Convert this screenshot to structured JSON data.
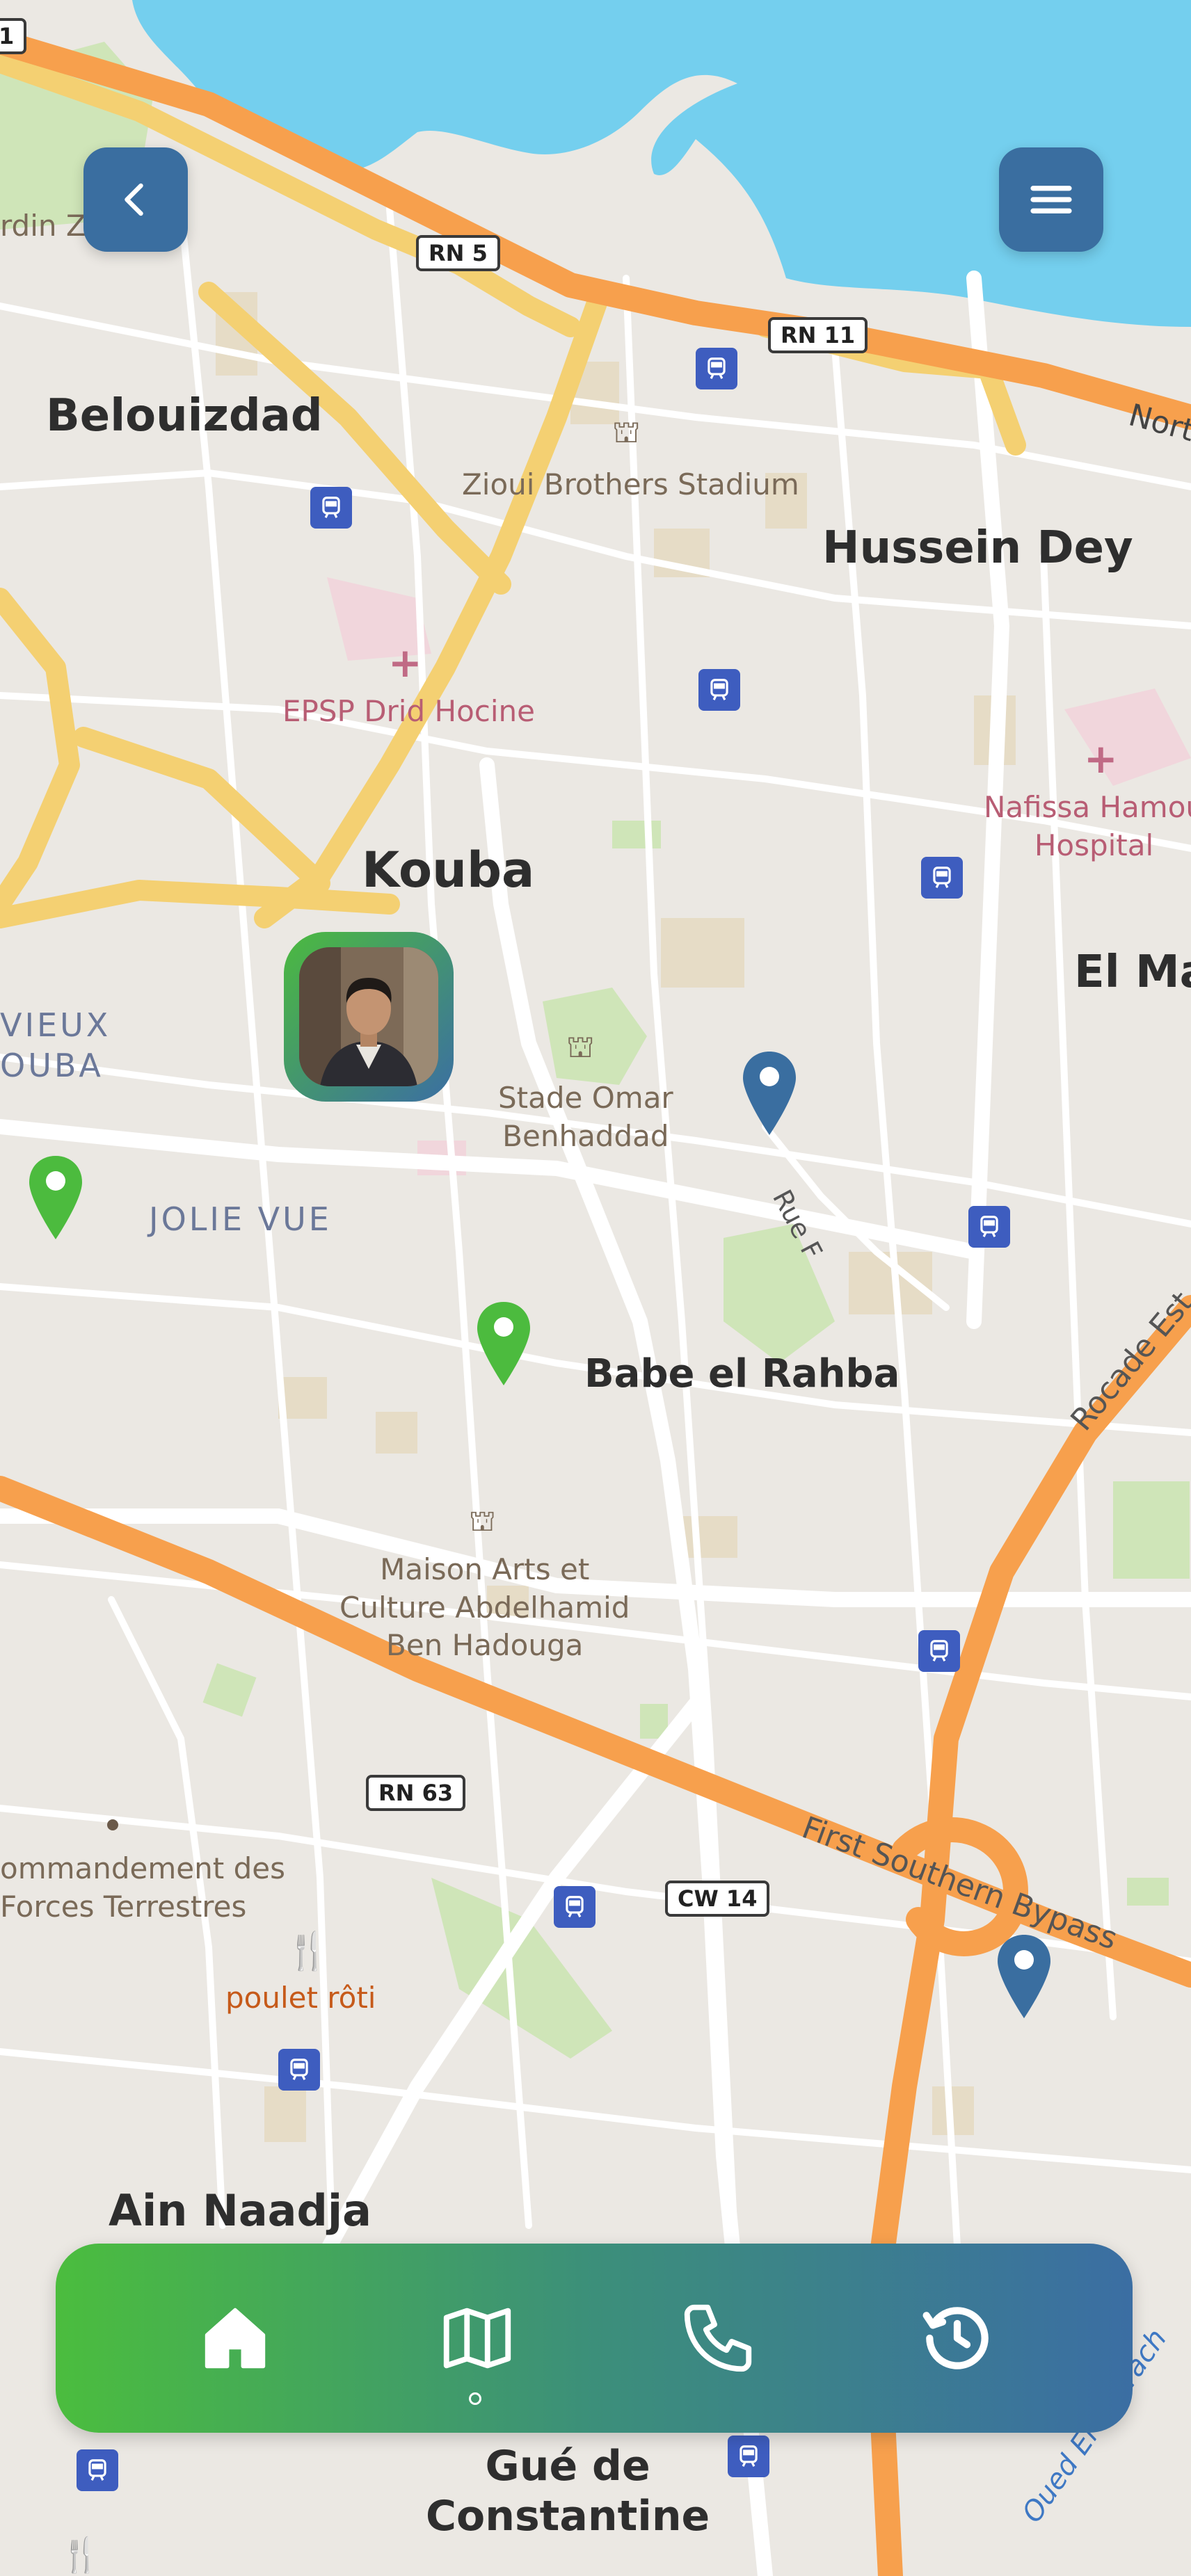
{
  "map": {
    "places": [
      {
        "id": "belouizdad",
        "name": "Belouizdad"
      },
      {
        "id": "hussein-dey",
        "name": "Hussein Dey"
      },
      {
        "id": "kouba",
        "name": "Kouba"
      },
      {
        "id": "el-ma",
        "name": "El Ma"
      },
      {
        "id": "babe-el-rahba",
        "name": "Babe el Rahba"
      },
      {
        "id": "ain-naadja",
        "name": "Ain Naadja"
      },
      {
        "id": "gue-de-constantine",
        "name": "Gué de\nConstantine"
      }
    ],
    "districts": [
      {
        "id": "vieux-kouba",
        "name": "VIEUX\nOUBA"
      },
      {
        "id": "jolie-vue",
        "name": "JOLIE VUE"
      }
    ],
    "pois": [
      {
        "id": "jardin",
        "name": "rdin Z      ue"
      },
      {
        "id": "zioui-stadium",
        "name": "Zioui Brothers Stadium"
      },
      {
        "id": "epsp",
        "name": "EPSP Drid Hocine"
      },
      {
        "id": "nafissa",
        "name": "Nafissa Hamou\nHospital"
      },
      {
        "id": "stade-omar",
        "name": "Stade Omar\nBenhaddad"
      },
      {
        "id": "maison-arts",
        "name": "Maison Arts et\nCulture Abdelhamid\nBen Hadouga"
      },
      {
        "id": "commandement",
        "name": "ommandement des\nForces Terrestres"
      },
      {
        "id": "poulet",
        "name": "poulet rôti"
      }
    ],
    "roads": [
      {
        "id": "rn5",
        "name": "RN 5"
      },
      {
        "id": "rn11",
        "name": "RN 11"
      },
      {
        "id": "rn63",
        "name": "RN 63"
      },
      {
        "id": "cw14",
        "name": "CW 14"
      },
      {
        "id": "first-bypass",
        "name": "First Southern Bypass"
      },
      {
        "id": "rue-f",
        "name": "Rue F"
      },
      {
        "id": "rocade",
        "name": "Rocade Est"
      },
      {
        "id": "nort",
        "name": "Nort"
      },
      {
        "id": "oued",
        "name": "Oued El Harrach"
      },
      {
        "id": "edge1",
        "name": "1"
      }
    ],
    "pins": [
      {
        "id": "pin-blue-1",
        "color": "#3a6ea0"
      },
      {
        "id": "pin-blue-2",
        "color": "#3a6ea0"
      },
      {
        "id": "pin-green-1",
        "color": "#4cbb3e"
      },
      {
        "id": "pin-green-2",
        "color": "#4cbb3e"
      }
    ]
  },
  "header": {
    "back_icon": "chevron-left-icon",
    "menu_icon": "hamburger-menu-icon"
  },
  "nav": {
    "items": [
      {
        "id": "home",
        "icon": "home-icon"
      },
      {
        "id": "map",
        "icon": "map-icon",
        "active": true
      },
      {
        "id": "call",
        "icon": "phone-icon"
      },
      {
        "id": "history",
        "icon": "history-icon"
      }
    ]
  },
  "colors": {
    "accent_green": "#4cbb3e",
    "accent_blue": "#3a6ea0",
    "water": "#74cfee",
    "major_road": "#f7a04d",
    "secondary_road": "#f4d072"
  }
}
